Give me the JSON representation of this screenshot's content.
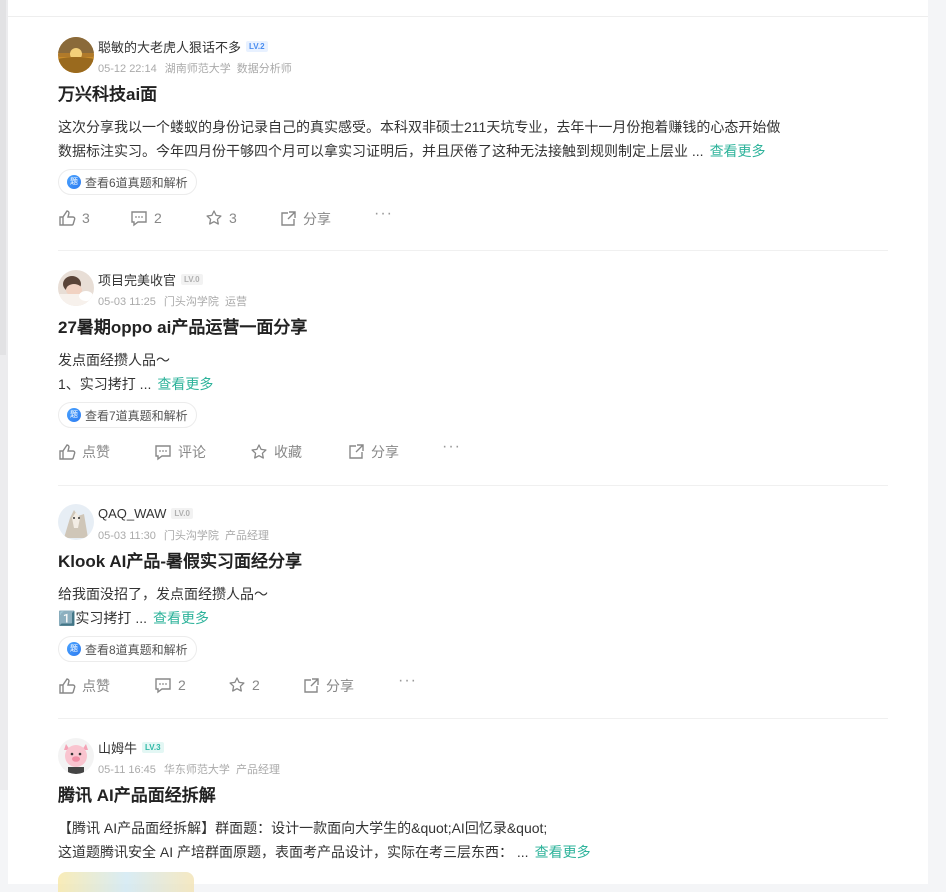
{
  "posts": [
    {
      "author": "聪敏的大老虎人狠话不多",
      "level": "LV.2",
      "time": "05-12 22:14",
      "school": "湖南师范大学",
      "role": "数据分析师",
      "title": "万兴科技ai面",
      "lines": [
        "这次分享我以一个蝼蚁的身份记录自己的真实感受。本科双非硕士211天坑专业，去年十一月份抱着赚钱的心态开始做",
        "数据标注实习。今年四月份干够四个月可以拿实习证明后，并且厌倦了这种无法接触到规则制定上层业 ..."
      ],
      "more": "查看更多",
      "tag": "查看6道真题和解析",
      "like": "3",
      "comment": "2",
      "fav": "3",
      "share": "分享"
    },
    {
      "author": "项目完美收官",
      "level": "LV.0",
      "time": "05-03 11:25",
      "school": "门头沟学院",
      "role": "运营",
      "title": "27暑期oppo ai产品运营一面分享",
      "lines": [
        "发点面经攒人品～",
        "1、实习拷打 ..."
      ],
      "more": "查看更多",
      "tag": "查看7道真题和解析",
      "like": "点赞",
      "comment": "评论",
      "fav": "收藏",
      "share": "分享"
    },
    {
      "author": "QAQ_WAW",
      "level": "LV.0",
      "time": "05-03 11:30",
      "school": "门头沟学院",
      "role": "产品经理",
      "title": "Klook AI产品-暑假实习面经分享",
      "lines": [
        "给我面没招了，发点面经攒人品～",
        "1️⃣实习拷打 ..."
      ],
      "more": "查看更多",
      "tag": "查看8道真题和解析",
      "like": "点赞",
      "comment": "2",
      "fav": "2",
      "share": "分享"
    },
    {
      "author": "山姆牛",
      "level": "LV.3",
      "time": "05-11 16:45",
      "school": "华东师范大学",
      "role": "产品经理",
      "title": "腾讯 AI产品面经拆解",
      "lines": [
        "【腾讯 AI产品面经拆解】群面题：设计一款面向大学生的&quot;AI回忆录&quot;",
        "这道题腾讯安全 AI 产培群面原题，表面考产品设计，实际在考三层东西： ..."
      ],
      "more": "查看更多"
    }
  ],
  "icons": {
    "like": "thumbs-up-icon",
    "comment": "comment-icon",
    "fav": "star-icon",
    "share": "share-icon",
    "more": "more-dots-icon",
    "tag": "question-badge-icon"
  },
  "more_dots": "···",
  "tag_icon_char": "题",
  "colors": {
    "accent": "#2eb39b",
    "lv2": "#4a8df0",
    "lv3": "#2fb8a6"
  }
}
